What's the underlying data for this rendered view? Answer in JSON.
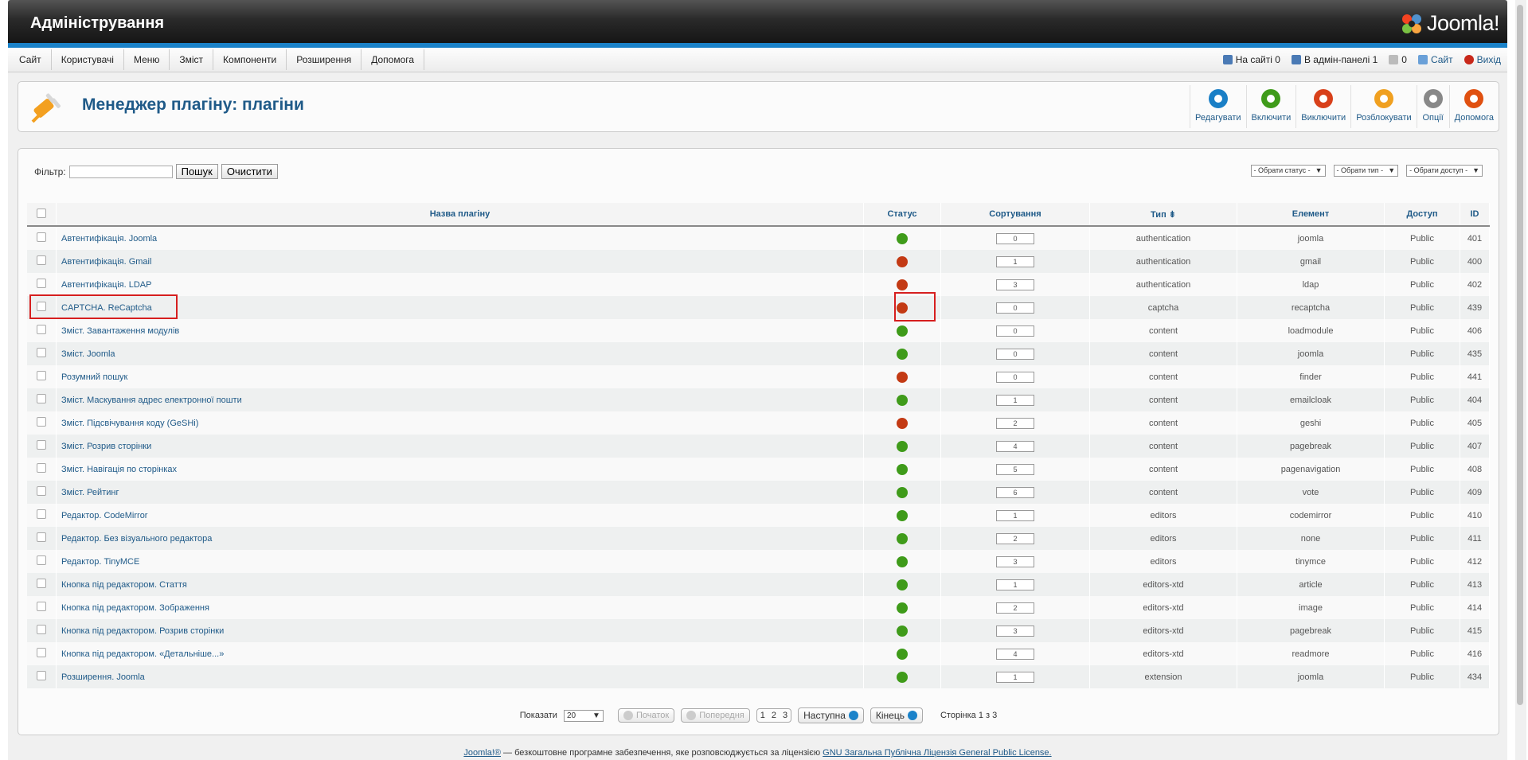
{
  "header": {
    "title": "Адміністрування",
    "logo": "Joomla!"
  },
  "menu": [
    "Сайт",
    "Користувачі",
    "Меню",
    "Зміст",
    "Компоненти",
    "Розширення",
    "Допомога"
  ],
  "status": {
    "on_site": "На сайті 0",
    "in_admin": "В адмін-панелі 1",
    "messages": "0",
    "site": "Сайт",
    "logout": "Вихід"
  },
  "page_title": "Менеджер плагіну: плагіни",
  "toolbar": [
    {
      "label": "Редагувати",
      "icon": "edit-icon",
      "color": "#1a7fc6"
    },
    {
      "label": "Включити",
      "icon": "publish-icon",
      "color": "#3f9b1a"
    },
    {
      "label": "Виключити",
      "icon": "unpublish-icon",
      "color": "#d8401a"
    },
    {
      "label": "Розблокувати",
      "icon": "checkin-icon",
      "color": "#f0a020"
    },
    {
      "label": "Опції",
      "icon": "options-icon",
      "color": "#888888"
    },
    {
      "label": "Допомога",
      "icon": "help-icon",
      "color": "#e05010"
    }
  ],
  "filter": {
    "label": "Фільтр:",
    "value": "",
    "search_btn": "Пошук",
    "clear_btn": "Очистити"
  },
  "selects": {
    "status": "- Обрати статус -",
    "type": "- Обрати тип -",
    "access": "- Обрати доступ -"
  },
  "columns": {
    "name": "Назва плагіну",
    "status": "Статус",
    "ordering": "Сортування",
    "type": "Тип",
    "element": "Елемент",
    "access": "Доступ",
    "id": "ID"
  },
  "rows": [
    {
      "name": "Автентифікація. Joomla",
      "status": "on",
      "order": "0",
      "type": "authentication",
      "element": "joomla",
      "access": "Public",
      "id": "401"
    },
    {
      "name": "Автентифікація. Gmail",
      "status": "off",
      "order": "1",
      "type": "authentication",
      "element": "gmail",
      "access": "Public",
      "id": "400"
    },
    {
      "name": "Автентифікація. LDAP",
      "status": "off",
      "order": "3",
      "type": "authentication",
      "element": "ldap",
      "access": "Public",
      "id": "402"
    },
    {
      "name": "CAPTCHA. ReCaptcha",
      "status": "off",
      "order": "0",
      "type": "captcha",
      "element": "recaptcha",
      "access": "Public",
      "id": "439"
    },
    {
      "name": "Зміст. Завантаження модулів",
      "status": "on",
      "order": "0",
      "type": "content",
      "element": "loadmodule",
      "access": "Public",
      "id": "406"
    },
    {
      "name": "Зміст. Joomla",
      "status": "on",
      "order": "0",
      "type": "content",
      "element": "joomla",
      "access": "Public",
      "id": "435"
    },
    {
      "name": "Розумний пошук",
      "status": "off",
      "order": "0",
      "type": "content",
      "element": "finder",
      "access": "Public",
      "id": "441"
    },
    {
      "name": "Зміст. Маскування адрес електронної пошти",
      "status": "on",
      "order": "1",
      "type": "content",
      "element": "emailcloak",
      "access": "Public",
      "id": "404"
    },
    {
      "name": "Зміст. Підсвічування коду (GeSHi)",
      "status": "off",
      "order": "2",
      "type": "content",
      "element": "geshi",
      "access": "Public",
      "id": "405"
    },
    {
      "name": "Зміст. Розрив сторінки",
      "status": "on",
      "order": "4",
      "type": "content",
      "element": "pagebreak",
      "access": "Public",
      "id": "407"
    },
    {
      "name": "Зміст. Навігація по сторінках",
      "status": "on",
      "order": "5",
      "type": "content",
      "element": "pagenavigation",
      "access": "Public",
      "id": "408"
    },
    {
      "name": "Зміст. Рейтинг",
      "status": "on",
      "order": "6",
      "type": "content",
      "element": "vote",
      "access": "Public",
      "id": "409"
    },
    {
      "name": "Редактор. CodeMirror",
      "status": "on",
      "order": "1",
      "type": "editors",
      "element": "codemirror",
      "access": "Public",
      "id": "410"
    },
    {
      "name": "Редактор. Без візуального редактора",
      "status": "on",
      "order": "2",
      "type": "editors",
      "element": "none",
      "access": "Public",
      "id": "411"
    },
    {
      "name": "Редактор. TinyMCE",
      "status": "on",
      "order": "3",
      "type": "editors",
      "element": "tinymce",
      "access": "Public",
      "id": "412"
    },
    {
      "name": "Кнопка під редактором. Стаття",
      "status": "on",
      "order": "1",
      "type": "editors-xtd",
      "element": "article",
      "access": "Public",
      "id": "413"
    },
    {
      "name": "Кнопка під редактором. Зображення",
      "status": "on",
      "order": "2",
      "type": "editors-xtd",
      "element": "image",
      "access": "Public",
      "id": "414"
    },
    {
      "name": "Кнопка під редактором. Розрив сторінки",
      "status": "on",
      "order": "3",
      "type": "editors-xtd",
      "element": "pagebreak",
      "access": "Public",
      "id": "415"
    },
    {
      "name": "Кнопка під редактором. «Детальніше...»",
      "status": "on",
      "order": "4",
      "type": "editors-xtd",
      "element": "readmore",
      "access": "Public",
      "id": "416"
    },
    {
      "name": "Розширення. Joomla",
      "status": "on",
      "order": "1",
      "type": "extension",
      "element": "joomla",
      "access": "Public",
      "id": "434"
    }
  ],
  "pager": {
    "show_label": "Показати",
    "limit": "20",
    "start": "Початок",
    "prev": "Попередня",
    "pages": [
      "1",
      "2",
      "3"
    ],
    "next": "Наступна",
    "end": "Кінець",
    "info": "Сторінка 1 з 3"
  },
  "footer": {
    "prefix": "Joomla!®",
    "text": " — безкоштовне програмне забезпечення, яке розповсюджується за ліцензією ",
    "license": "GNU Загальна Публічна Ліцензія General Public License."
  }
}
